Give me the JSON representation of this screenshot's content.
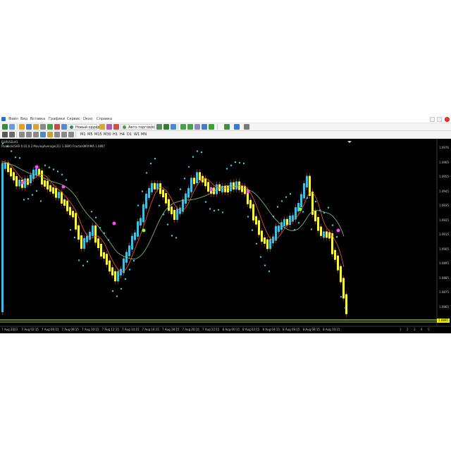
{
  "menu": [
    {
      "label": "Файл"
    },
    {
      "label": "Вид"
    },
    {
      "label": "Вставка"
    },
    {
      "label": "Графики"
    },
    {
      "label": "Сервис"
    },
    {
      "label": "Окно"
    },
    {
      "label": "Справка"
    }
  ],
  "toolbar": {
    "new_order_label": "Новый ордер",
    "autotrade_label": "Авто-торговля",
    "timeframes": [
      "M1",
      "M5",
      "M15",
      "M30",
      "H1",
      "H4",
      "D1",
      "W1",
      "MN"
    ],
    "timeframes2": [
      "H1",
      "H4",
      "D1",
      "W1",
      "MN"
    ]
  },
  "chart": {
    "symbol_line": "EURUSD,H1",
    "indicator_line": "ParabolicSAR 0.02,0.2  MovingAverage(21) 1.0895  FractalsWithMA 1.0897",
    "current_price": "1.0895",
    "y_labels": [
      "1.0976",
      "1.0965",
      "1.0955",
      "1.0945",
      "1.0935",
      "1.0925",
      "1.0915",
      "1.0905",
      "1.0895",
      "1.0885",
      "1.0875",
      "1.0865",
      "1.0855"
    ],
    "x_labels": [
      "7 Aug 2023",
      "7 Aug 02:15",
      "7 Aug 06:15",
      "7 Aug 08:15",
      "7 Aug 10:15",
      "7 Aug 12:15",
      "7 Aug 14:15",
      "7 Aug 16:15",
      "7 Aug 18:15",
      "7 Aug 20:15",
      "7 Aug 22:15",
      "8 Aug 00:15",
      "8 Aug 02:15",
      "8 Aug 04:15",
      "8 Aug 06:15",
      "8 Aug 08:15",
      "8 Aug 10:15"
    ],
    "tabs": [
      "1",
      "2",
      "3",
      "4",
      "5"
    ],
    "colors": {
      "background": "#000000",
      "bull_candle": "#2ec4f0",
      "bear_candle": "#ffff28",
      "wick": "#ff3a3a",
      "sar_dot": "#3fd0e8",
      "ma_fast": "#ff5a2a",
      "ma_slow": "#88c878",
      "signal_buy": "#7cff3a",
      "signal_sell": "#ff4aff",
      "price_line": "#f2f200"
    }
  }
}
